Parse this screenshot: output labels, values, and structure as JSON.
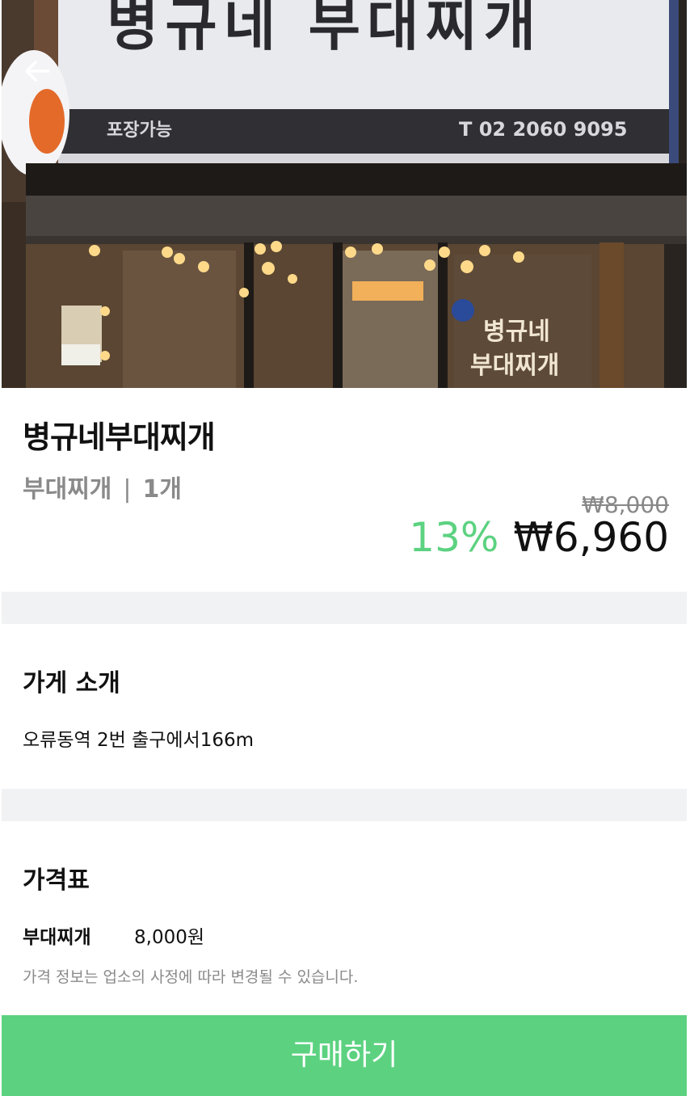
{
  "hero": {
    "sign_text": "병규네 부대찌개",
    "sign_takeout": "포장가능",
    "sign_phone": "T  02 2060 9095",
    "window_text_1": "병규네",
    "window_text_2": "부대찌개",
    "back_icon": "arrow-left-icon"
  },
  "store": {
    "name": "병규네부대찌개",
    "menu": "부대찌개",
    "separator": "|",
    "quantity": "1개",
    "original_price": "₩8,000",
    "discount": "13%",
    "final_price": "₩6,960"
  },
  "intro": {
    "title": "가게 소개",
    "text": "오류동역 2번 출구에서166m"
  },
  "price_table": {
    "title": "가격표",
    "items": [
      {
        "name": "부대찌개",
        "price": "8,000원"
      }
    ],
    "notice": "가격 정보는 업소의 사정에 따라 변경될 수 있습니다."
  },
  "buy_button": {
    "label": "구매하기"
  },
  "colors": {
    "accent_green": "#5cd280",
    "divider_gray": "#f1f2f4",
    "muted_text": "#8a8a8a"
  }
}
